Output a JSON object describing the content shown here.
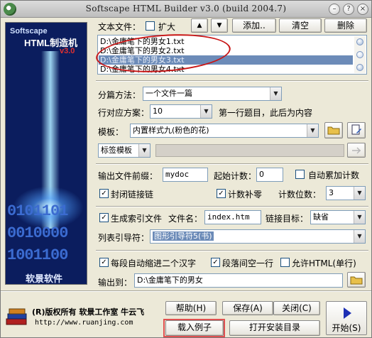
{
  "window": {
    "title": "Softscape HTML Builder v3.0 (build 2004.7)",
    "minimize_glyph": "–",
    "help_glyph": "?",
    "close_glyph": "×"
  },
  "banner": {
    "brand": "Softscape",
    "product": "HTML制造机",
    "version": "v3.0",
    "digits": [
      "0101101",
      "0010000",
      "1001100"
    ],
    "footer": "软景软件"
  },
  "files": {
    "label": "文本文件：",
    "expand_label": "扩大",
    "expand_checked": false,
    "up_glyph": "▲",
    "down_glyph": "▼",
    "add_label": "添加..",
    "clear_label": "清空",
    "delete_label": "删除",
    "items": [
      "D:\\金庸笔下的男女1.txt",
      "D:\\金庸笔下的男女2.txt",
      "D:\\金庸笔下的男女3.txt",
      "D:\\金庸笔下的男女4.txt"
    ],
    "selected_index": 2
  },
  "split": {
    "label": "分篇方法：",
    "value": "一个文件一篇"
  },
  "rows": {
    "label": "行对应方案：",
    "value": "10",
    "hint": "第一行题目，此后为内容"
  },
  "template": {
    "label": "模板：",
    "value": "内置样式九(粉色的花)"
  },
  "tag_template": {
    "value": "标签模板"
  },
  "output": {
    "prefix_label": "输出文件前缀：",
    "prefix_value": "mydoc",
    "start_label": "起始计数：",
    "start_value": "0",
    "auto_label": "自动累加计数",
    "auto_checked": false,
    "close_link_label": "封闭链接链",
    "close_link_checked": true,
    "pad_label": "计数补零",
    "pad_checked": true,
    "digits_label": "计数位数：",
    "digits_value": "3"
  },
  "index": {
    "gen_label": "生成索引文件",
    "gen_checked": true,
    "filename_label": "文件名：",
    "filename_value": "index.htm",
    "target_label": "链接目标：",
    "target_value": "缺省",
    "list_label": "列表引导符：",
    "list_value": "图形引导符5(书)"
  },
  "options": {
    "indent_label": "每段自动缩进二个汉字",
    "indent_checked": true,
    "blankline_label": "段落间空一行",
    "blankline_checked": true,
    "allow_html_label": "允许HTML(单行)",
    "allow_html_checked": false,
    "output_to_label": "输出到：",
    "output_to_value": "D:\\金庸笔下的男女"
  },
  "footer": {
    "copyright": "(R)版权所有 软景工作室 牛云飞",
    "url": "http://www.ruanjing.com",
    "help_label": "帮助(H)",
    "save_label": "保存(A)",
    "close_label": "关闭(C)",
    "example_label": "载入例子",
    "open_dir_label": "打开安装目录",
    "start_label": "开始(S)"
  },
  "colors": {
    "selection": "#6c8bb8",
    "annotation": "#c81414",
    "banner_bg": "#0b1d5e",
    "play": "#1d2fb4"
  }
}
